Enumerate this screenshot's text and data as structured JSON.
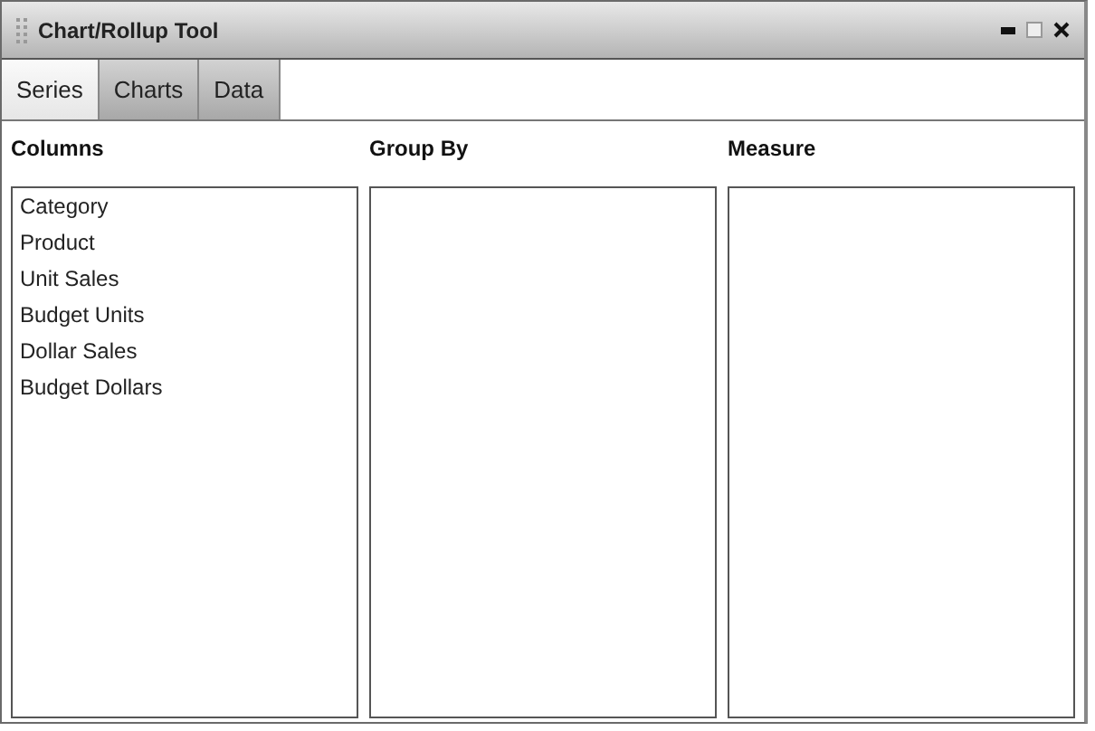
{
  "window": {
    "title": "Chart/Rollup Tool"
  },
  "tabs": [
    {
      "label": "Series",
      "selected": true
    },
    {
      "label": "Charts",
      "selected": false
    },
    {
      "label": "Data",
      "selected": false
    }
  ],
  "panels": [
    {
      "heading": "Columns",
      "items": [
        "Category",
        "Product",
        "Unit Sales",
        "Budget Units",
        "Dollar Sales",
        "Budget Dollars"
      ]
    },
    {
      "heading": "Group By"
    },
    {
      "heading": "Measure"
    }
  ]
}
